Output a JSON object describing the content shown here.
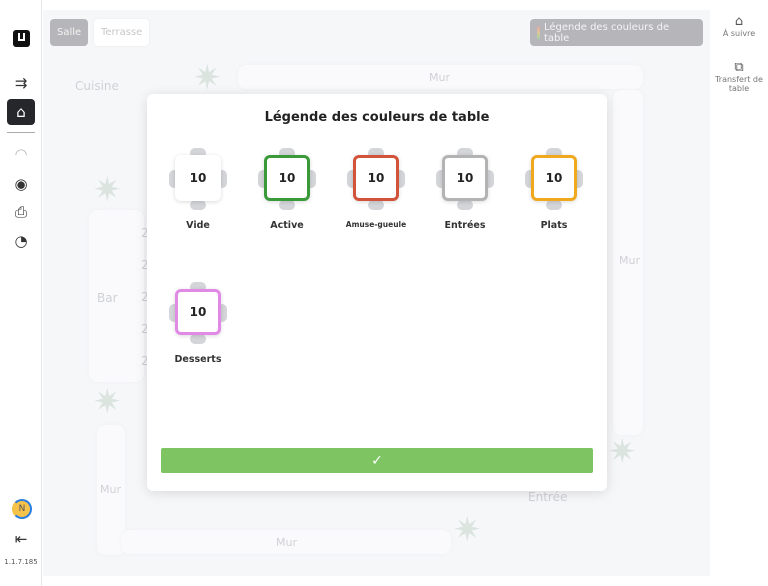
{
  "sidebar": {
    "version": "1.1.7.185",
    "avatar": "N",
    "icons": [
      "logo-icon",
      "expand-icon",
      "home-icon",
      "service-bell-icon",
      "eye-icon",
      "printer-icon",
      "pie-chart-icon",
      "logout-icon"
    ]
  },
  "tabs": [
    {
      "label": "Salle",
      "active": true
    },
    {
      "label": "Terrasse",
      "active": false
    }
  ],
  "legend_button": "Légende des couleurs de table",
  "right_panel": [
    {
      "label": "À suivre",
      "icon": "follow-icon"
    },
    {
      "label": "Transfert de table",
      "icon": "transfer-icon"
    }
  ],
  "floor": {
    "cuisine": "Cuisine",
    "bar": "Bar",
    "entree": "Entrée",
    "mur": "Mur",
    "seat": "2"
  },
  "modal": {
    "title": "Légende des couleurs de table",
    "confirm_icon": "check-icon",
    "items": [
      {
        "number": "10",
        "label": "Vide",
        "color": "#ffffff"
      },
      {
        "number": "10",
        "label": "Active",
        "color": "#3a9a3a"
      },
      {
        "number": "10",
        "label": "Amuse-gueule",
        "color": "#d0533a"
      },
      {
        "number": "10",
        "label": "Entrées",
        "color": "#b3b3b3"
      },
      {
        "number": "10",
        "label": "Plats",
        "color": "#f0a81e"
      },
      {
        "number": "10",
        "label": "Desserts",
        "color": "#e08ae6"
      }
    ]
  }
}
